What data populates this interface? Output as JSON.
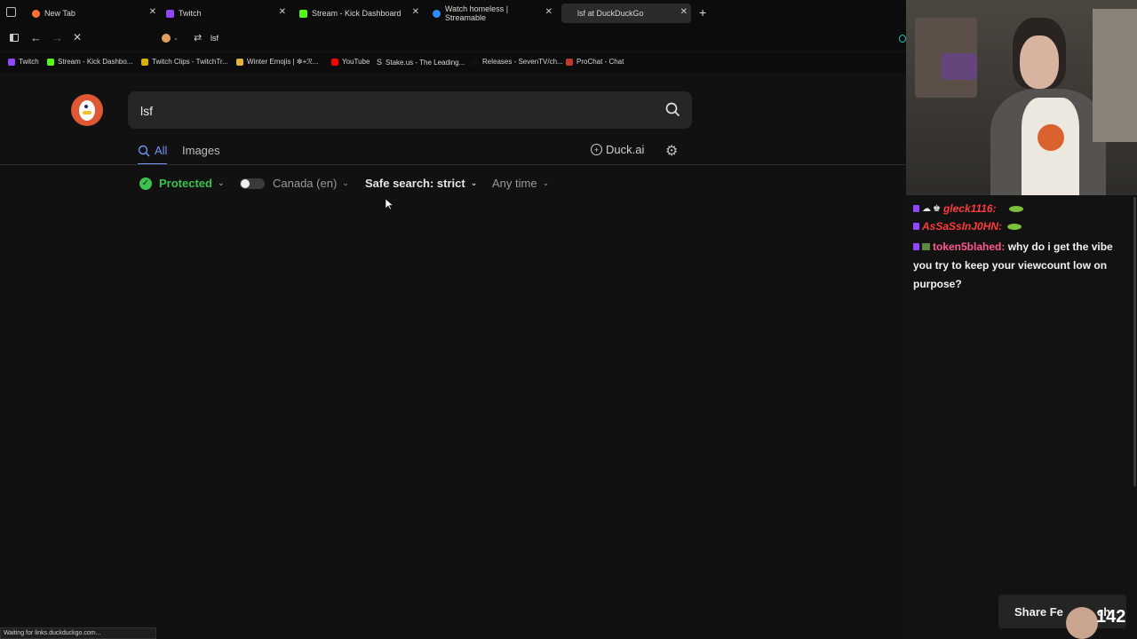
{
  "tabs": [
    {
      "label": "New Tab",
      "active": false
    },
    {
      "label": "Twitch",
      "active": false
    },
    {
      "label": "Stream - Kick Dashboard",
      "active": false
    },
    {
      "label": "Watch homeless | Streamable",
      "active": false
    },
    {
      "label": "lsf at DuckDuckGo",
      "active": true
    }
  ],
  "address": {
    "url": "lsf"
  },
  "bookmarks": [
    "Twitch",
    "Stream - Kick Dashbo...",
    "Twitch Clips - TwitchTr...",
    "Winter Emojis | ✼+ℛ...",
    "YouTube",
    "Stake.us - The Leading...",
    "Releases - SevenTV/ch...",
    "ProChat - Chat"
  ],
  "search": {
    "query": "lsf"
  },
  "nav_tabs": {
    "all": "All",
    "images": "Images"
  },
  "duck_ai": "Duck.ai",
  "filters": {
    "protected": "Protected",
    "region": "Canada (en)",
    "safe": "Safe search: strict",
    "time": "Any time"
  },
  "status_bar": "Waiting for links.duckduckgo.com...",
  "chat": [
    {
      "user": "gleck1116:",
      "color": "#ff3b3b",
      "text": ""
    },
    {
      "user": "AsSaSsInJ0HN:",
      "color": "#ff3b3b",
      "text": ""
    },
    {
      "user": "token5blahed:",
      "color": "#ff5a8c",
      "text": "why do i get the vibe you try to keep your viewcount low on purpose?"
    }
  ],
  "share": {
    "label": "Share Fe",
    "suffix": "ch",
    "count": "142"
  },
  "colors": {
    "accent": "#7295f6",
    "protected": "#3fc14f",
    "bg": "#111111"
  }
}
